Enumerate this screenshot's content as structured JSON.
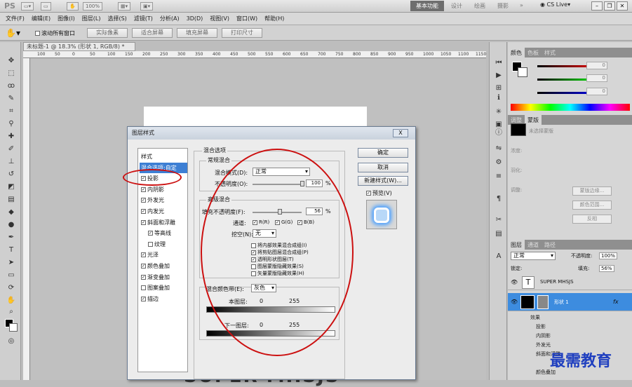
{
  "app": {
    "logo": "PS",
    "zoom": "100%",
    "workspace_active": "基本功能",
    "workspaces": [
      "设计",
      "绘画",
      "摄影"
    ],
    "more": "»",
    "cs_live": "CS Live▾"
  },
  "menu": [
    "文件(F)",
    "编辑(E)",
    "图像(I)",
    "图层(L)",
    "选择(S)",
    "滤镜(T)",
    "分析(A)",
    "3D(D)",
    "视图(V)",
    "窗口(W)",
    "帮助(H)"
  ],
  "options": {
    "scroll_all": "滚动所有窗口",
    "buttons": [
      "实际像素",
      "适合屏幕",
      "填充屏幕",
      "打印尺寸"
    ]
  },
  "document": {
    "tab": "未标题-1 @ 18.3% (形状 1, RGB/8) *",
    "ruler": [
      "100",
      "50",
      "0",
      "50",
      "100",
      "150",
      "200",
      "250",
      "300",
      "350",
      "400",
      "450",
      "500",
      "550",
      "600",
      "650",
      "700",
      "750",
      "800",
      "850",
      "900",
      "950",
      "1000",
      "1050",
      "1100",
      "1150"
    ],
    "canvas_text": "SUPER MHSJS"
  },
  "panel_color": {
    "tabs": [
      "颜色",
      "色板",
      "样式"
    ],
    "values": [
      "0",
      "0",
      "0"
    ]
  },
  "panel_adjust": {
    "tabs": [
      "调整",
      "蒙版"
    ],
    "hint": "未选择蒙版",
    "density": "浓度:",
    "feather": "羽化:",
    "refine": "调整:",
    "buttons": [
      "蒙版边缘...",
      "颜色范围...",
      "反相"
    ]
  },
  "panel_layers": {
    "tabs": [
      "图层",
      "通道",
      "路径"
    ],
    "mode": "正常",
    "opacity_label": "不透明度:",
    "opacity": "100%",
    "lock_label": "锁定:",
    "fill_label": "填充:",
    "fill": "56%",
    "layers": [
      {
        "name": "SUPER MHSJS",
        "thumb": "T"
      },
      {
        "name": "形状 1",
        "fx": "fx"
      }
    ],
    "effects_label": "效果",
    "effects": [
      "投影",
      "内阴影",
      "外发光",
      "斜面和浮雕",
      "颜色叠加"
    ]
  },
  "dialog": {
    "title": "图层样式",
    "close": "X",
    "style_list": [
      {
        "label": "样式",
        "checkbox": false
      },
      {
        "label": "混合选项:自定",
        "checkbox": false,
        "selected": true
      },
      {
        "label": "投影",
        "checkbox": true,
        "checked": true
      },
      {
        "label": "内阴影",
        "checkbox": true,
        "checked": true
      },
      {
        "label": "外发光",
        "checkbox": true,
        "checked": true
      },
      {
        "label": "内发光",
        "checkbox": true,
        "checked": true
      },
      {
        "label": "斜面和浮雕",
        "checkbox": true,
        "checked": true
      },
      {
        "label": "等高线",
        "checkbox": true,
        "checked": true,
        "sub": true
      },
      {
        "label": "纹理",
        "checkbox": true,
        "checked": false,
        "sub": true
      },
      {
        "label": "光泽",
        "checkbox": true,
        "checked": true
      },
      {
        "label": "颜色叠加",
        "checkbox": true,
        "checked": true
      },
      {
        "label": "渐变叠加",
        "checkbox": true,
        "checked": true
      },
      {
        "label": "图案叠加",
        "checkbox": true,
        "checked": false
      },
      {
        "label": "描边",
        "checkbox": true,
        "checked": true
      }
    ],
    "blend_options_title": "混合选项",
    "general_blend": "常规混合",
    "blend_mode_label": "混合模式(D):",
    "blend_mode": "正常",
    "opacity_label": "不透明度(O):",
    "opacity_value": "100",
    "percent": "%",
    "advanced_blend": "高级混合",
    "fill_opacity_label": "填充不透明度(F):",
    "fill_opacity_value": "56",
    "channels_label": "通道:",
    "channels": [
      "R(R)",
      "G(G)",
      "B(B)"
    ],
    "knockout_label": "挖空(N):",
    "knockout": "无",
    "options": [
      {
        "label": "将内部效果混合成组(I)",
        "checked": false
      },
      {
        "label": "将剪贴图层混合成组(P)",
        "checked": true
      },
      {
        "label": "透明形状图层(T)",
        "checked": true
      },
      {
        "label": "图层蒙版隐藏效果(S)",
        "checked": false
      },
      {
        "label": "矢量蒙版隐藏效果(H)",
        "checked": false
      }
    ],
    "blend_if_label": "混合颜色带(E):",
    "blend_if": "灰色",
    "this_layer": "本图层:",
    "underlying": "下一图层:",
    "range_min": "0",
    "range_max": "255",
    "buttons": {
      "ok": "确定",
      "cancel": "取消",
      "new_style": "新建样式(W)...",
      "preview": "预览(V)"
    }
  },
  "watermark": "最需教育",
  "colors": {
    "accent": "#3d7fd4",
    "annotation": "#cc1010"
  }
}
